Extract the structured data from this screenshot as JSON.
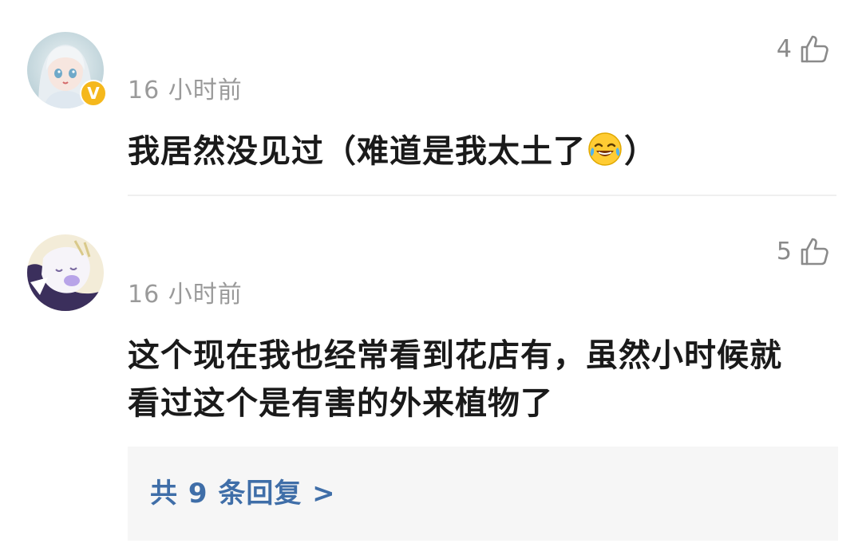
{
  "comments": [
    {
      "avatar_icon": "user-avatar-anime-girl",
      "verified_badge": "V",
      "time": "16 小时前",
      "likes": "4",
      "text_before_emoji": "我居然没见过（难道是我太土了",
      "emoji": "laughing-crying-emoji",
      "text_after_emoji": "）"
    },
    {
      "avatar_icon": "user-avatar-anime-character",
      "time": "16 小时前",
      "likes": "5",
      "text": "这个现在我也经常看到花店有，虽然小时候就看过这个是有害的外来植物了",
      "replies_label": "共 9 条回复 >"
    }
  ],
  "colors": {
    "time_text": "#9a9a9a",
    "body_text": "#1a1a1a",
    "reply_link": "#3f6ea8",
    "verified_badge": "#f5b81c",
    "reply_bg": "#f6f6f6"
  }
}
